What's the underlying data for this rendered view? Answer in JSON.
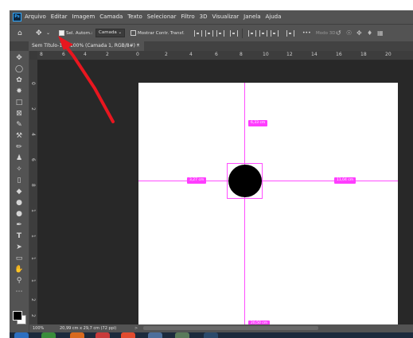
{
  "app": {
    "logo_text": "Ps",
    "menu": [
      "Arquivo",
      "Editar",
      "Imagem",
      "Camada",
      "Texto",
      "Selecionar",
      "Filtro",
      "3D",
      "Visualizar",
      "Janela",
      "Ajuda"
    ]
  },
  "options": {
    "home_icon": "home-icon",
    "move_icon": "move-tool-icon",
    "auto_select_label": "Sel. Autom.:",
    "auto_select_checked": true,
    "layer_dropdown": "Camada",
    "show_transform_label": "Mostrar Contr. Transf.",
    "show_transform_checked": false,
    "more_label": "•••",
    "mode_3d_label": "Modo 3D:"
  },
  "document": {
    "tab_title": "Sem Título-1 @ 100% (Camada 1, RGB/8#) *",
    "tab_close": "×"
  },
  "rulers": {
    "top_ticks": [
      "8",
      "6",
      "4",
      "2",
      "0",
      "2",
      "4",
      "6",
      "8",
      "10",
      "12",
      "14",
      "16",
      "18",
      "20"
    ],
    "left_ticks": [
      "0",
      "2",
      "4",
      "6",
      "8",
      "1",
      "1",
      "1",
      "1",
      "2",
      "2"
    ]
  },
  "canvas": {
    "measure_top": "6,33 cm",
    "measure_left": "3,27 cm",
    "measure_right": "11,04 cm",
    "measure_bottom": "20,50 cm"
  },
  "status": {
    "zoom": "100%",
    "doc_size": "20,99 cm x 29,7 cm (72 ppi)",
    "arrow": ">"
  },
  "colors": {
    "guide": "#ff4dff",
    "annotation_arrow": "#e8161f",
    "ui_dark": "#535353",
    "workspace": "#282828"
  }
}
